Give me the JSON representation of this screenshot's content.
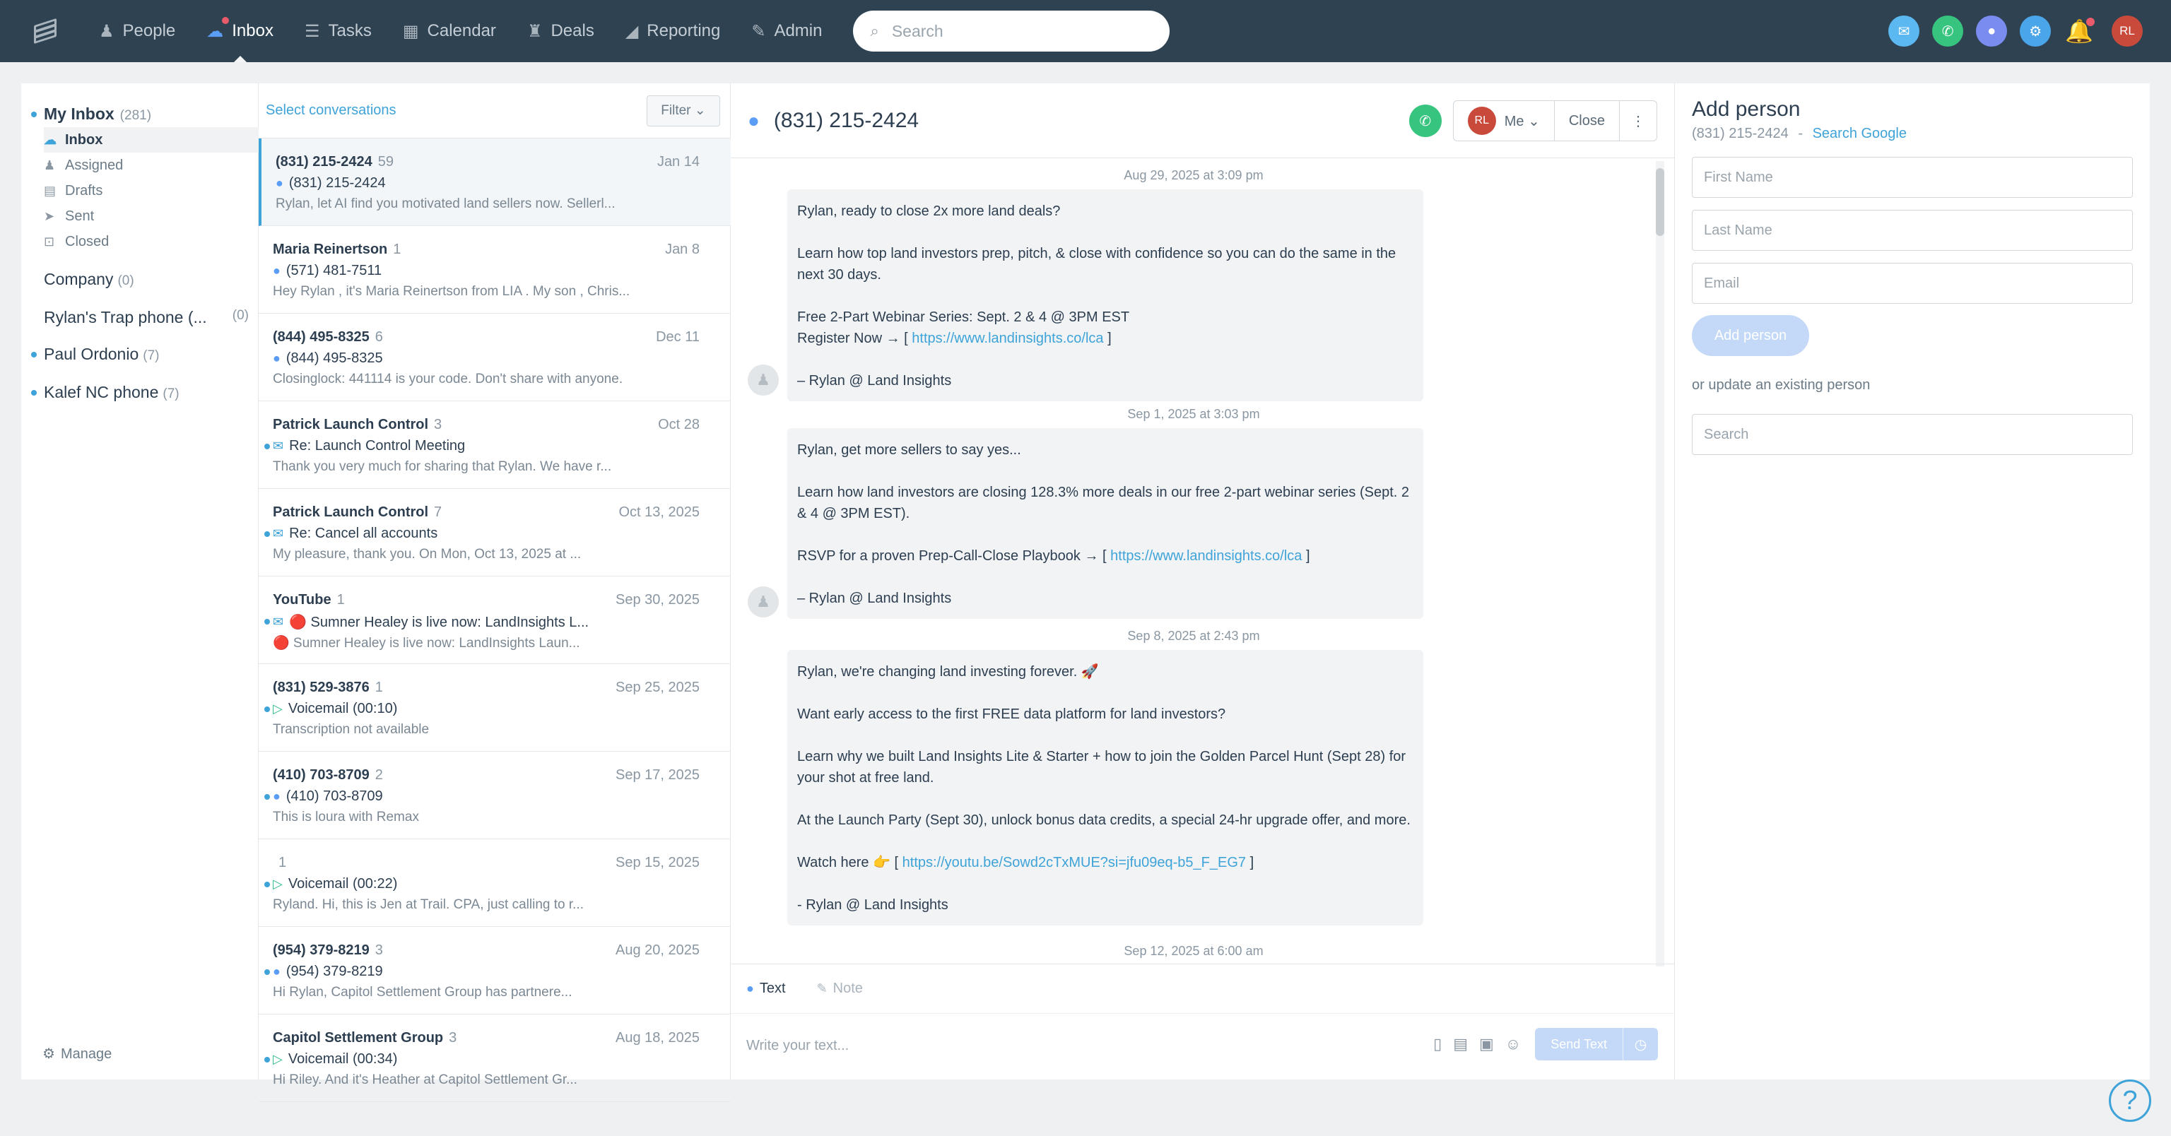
{
  "nav": {
    "items": [
      {
        "icon": "person-icon",
        "glyph": "♟",
        "label": "People"
      },
      {
        "icon": "inbox-icon",
        "glyph": "☁",
        "label": "Inbox"
      },
      {
        "icon": "tasks-icon",
        "glyph": "☰",
        "label": "Tasks"
      },
      {
        "icon": "calendar-icon",
        "glyph": "▦",
        "label": "Calendar"
      },
      {
        "icon": "deals-icon",
        "glyph": "♜",
        "label": "Deals"
      },
      {
        "icon": "reporting-icon",
        "glyph": "◢",
        "label": "Reporting"
      },
      {
        "icon": "admin-icon",
        "glyph": "✎",
        "label": "Admin"
      }
    ],
    "search_placeholder": "Search",
    "user_initials": "RL"
  },
  "sidebar": {
    "title": "My Inbox",
    "title_count": "(281)",
    "subitems": [
      {
        "label": "Inbox",
        "icon": "inbox-icon",
        "glyph": "☁"
      },
      {
        "label": "Assigned",
        "icon": "person-icon",
        "glyph": "♟"
      },
      {
        "label": "Drafts",
        "icon": "draft-icon",
        "glyph": "▤"
      },
      {
        "label": "Sent",
        "icon": "send-icon",
        "glyph": "➤"
      },
      {
        "label": "Closed",
        "icon": "closed-icon",
        "glyph": "⊡"
      }
    ],
    "groups": [
      {
        "label": "Company",
        "count": "(0)"
      },
      {
        "label": "Rylan's Trap phone (...",
        "count": "(0)"
      },
      {
        "label": "Paul Ordonio",
        "count": "(7)"
      },
      {
        "label": "Kalef NC phone",
        "count": "(7)"
      }
    ],
    "manage": "Manage"
  },
  "list": {
    "select_label": "Select conversations",
    "filter_label": "Filter ⌄",
    "conversations": [
      {
        "name": "(831) 215-2424",
        "count": "59",
        "date": "Jan 14",
        "icon": "msg",
        "glyph": "●",
        "subject": "(831) 215-2424",
        "preview": "Rylan, let AI find you motivated land sellers now. Sellerl..."
      },
      {
        "name": "Maria Reinertson",
        "count": "1",
        "date": "Jan 8",
        "icon": "msg",
        "glyph": "●",
        "subject": "(571) 481-7511",
        "preview": "Hey Rylan , it's Maria Reinertson from LIA . My son , Chris..."
      },
      {
        "name": "(844) 495-8325",
        "count": "6",
        "date": "Dec 11",
        "icon": "msg",
        "glyph": "●",
        "subject": "(844) 495-8325",
        "preview": "Closinglock: 441114 is your code. Don't share with anyone."
      },
      {
        "name": "Patrick Launch Control",
        "count": "3",
        "date": "Oct 28",
        "icon": "mail",
        "glyph": "✉",
        "subject": "Re: Launch Control Meeting",
        "preview": "Thank you very much for sharing that Rylan. We have r..."
      },
      {
        "name": "Patrick Launch Control",
        "count": "7",
        "date": "Oct 13, 2025",
        "icon": "mail",
        "glyph": "✉",
        "subject": "Re: Cancel all accounts",
        "preview": "My pleasure, thank you. On Mon, Oct 13, 2025 at ..."
      },
      {
        "name": "YouTube",
        "count": "1",
        "date": "Sep 30, 2025",
        "icon": "mail",
        "glyph": "✉",
        "subject": "🔴 Sumner Healey is live now: LandInsights L...",
        "preview": "🔴 Sumner Healey is live now: LandInsights Laun..."
      },
      {
        "name": "(831) 529-3876",
        "count": "1",
        "date": "Sep 25, 2025",
        "icon": "vm",
        "glyph": "▷",
        "subject": "Voicemail (00:10)",
        "preview": "Transcription not available"
      },
      {
        "name": "(410) 703-8709",
        "count": "2",
        "date": "Sep 17, 2025",
        "icon": "msg",
        "glyph": "●",
        "subject": "(410) 703-8709",
        "preview": "This is loura with Remax"
      },
      {
        "name": "",
        "count": "1",
        "date": "Sep 15, 2025",
        "icon": "vm",
        "glyph": "▷",
        "subject": "Voicemail (00:22)",
        "preview": "Ryland. Hi, this is Jen at Trail. CPA, just calling to r..."
      },
      {
        "name": "(954) 379-8219",
        "count": "3",
        "date": "Aug 20, 2025",
        "icon": "msg",
        "glyph": "●",
        "subject": "(954) 379-8219",
        "preview": "Hi Rylan, Capitol Settlement Group has partnere..."
      },
      {
        "name": "Capitol Settlement Group",
        "count": "3",
        "date": "Aug 18, 2025",
        "icon": "vm",
        "glyph": "▷",
        "subject": "Voicemail (00:34)",
        "preview": "Hi Riley. And it's Heather at Capitol Settlement Gr..."
      }
    ]
  },
  "thread": {
    "title": "(831) 215-2424",
    "assignee_initials": "RL",
    "assignee_label": "Me ⌄",
    "close_label": "Close",
    "more_glyph": "⋮",
    "timestamps": [
      "Aug 29, 2025 at 3:09 pm",
      "Sep 1, 2025 at 3:03 pm",
      "Sep 8, 2025 at 2:43 pm",
      "Sep 12, 2025 at 6:00 am"
    ],
    "messages": [
      {
        "lines": [
          "Rylan, ready to close 2x more land deals?",
          "",
          "Learn how top land investors prep, pitch, & close with confidence so you can do the same in the next 30 days.",
          "",
          "Free 2-Part Webinar Series: Sept. 2 & 4 @ 3PM EST"
        ],
        "link_prefix": "Register Now → [ ",
        "link": "https://www.landinsights.co/lca",
        "link_suffix": " ]",
        "signature": "– Rylan @ Land Insights"
      },
      {
        "lines": [
          "Rylan, get more sellers to say yes...",
          "",
          "Learn how land investors are closing 128.3% more deals in our free 2-part webinar series (Sept. 2 & 4 @ 3PM EST).",
          ""
        ],
        "link_prefix": "RSVP for a proven Prep-Call-Close Playbook → [ ",
        "link": "https://www.landinsights.co/lca",
        "link_suffix": " ]",
        "signature": "– Rylan @ Land Insights"
      },
      {
        "lines": [
          "Rylan, we're changing land investing forever. 🚀",
          "",
          "Want early access to the first FREE data platform for land investors?",
          "",
          "Learn why we built Land Insights Lite & Starter + how to join the Golden Parcel Hunt (Sept 28) for your shot at free land.",
          "",
          "At the Launch Party (Sept 30), unlock bonus data credits, a special 24-hr upgrade offer, and more.",
          ""
        ],
        "link_prefix": "Watch here 👉 [ ",
        "link": "https://youtu.be/Sowd2cTxMUE?si=jfu09eq-b5_F_EG7",
        "link_suffix": " ]",
        "signature": "- Rylan @ Land Insights"
      }
    ],
    "tabs": {
      "text": "Text",
      "note": "Note"
    },
    "input_placeholder": "Write your text...",
    "send_label": "Send Text"
  },
  "add_person": {
    "title": "Add person",
    "phone": "(831) 215-2424",
    "separator": "-",
    "search_google": "Search Google",
    "first_name": "First Name",
    "last_name": "Last Name",
    "email": "Email",
    "add_button": "Add person",
    "or_update": "or update an existing person",
    "search_placeholder": "Search"
  },
  "help_glyph": "?",
  "colors": {
    "nav_bg": "#2e4251",
    "accent": "#3ea3d8",
    "call_green": "#37c47e",
    "avatar_red": "#c94a3b"
  }
}
